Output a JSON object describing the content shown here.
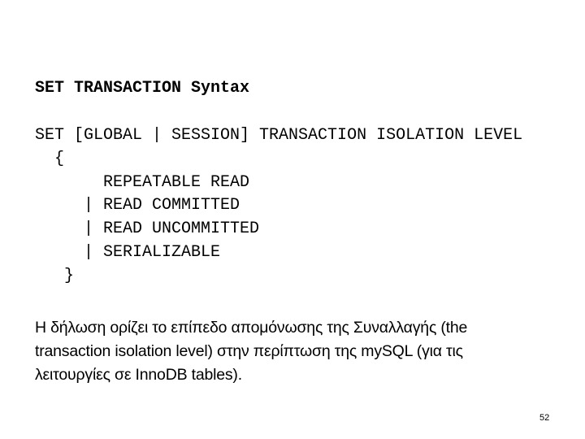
{
  "slide": {
    "title": "SET TRANSACTION Syntax",
    "code_lines": [
      "SET [GLOBAL | SESSION] TRANSACTION ISOLATION LEVEL",
      "  {",
      "       REPEATABLE READ",
      "     | READ COMMITTED",
      "     | READ UNCOMMITTED",
      "     | SERIALIZABLE",
      "   }"
    ],
    "description_lines": [
      "Η δήλωση ορίζει το επίπεδο απομόνωσης της Συναλλαγής (the",
      "transaction isolation level) στην περίπτωση της mySQL (για τις",
      "λειτουργίες σε InnoDB tables)."
    ],
    "page_number": "52"
  }
}
